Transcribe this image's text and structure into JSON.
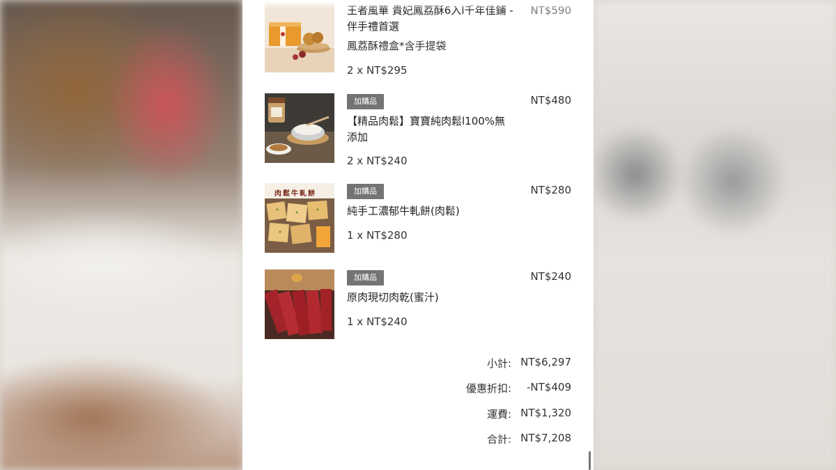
{
  "items": [
    {
      "name": "王者風華 貴妃鳳荔酥6入l千年佳鋪 - 伴手禮首選",
      "option": "鳳荔酥禮盒*含手提袋",
      "qty": "2 x NT$295",
      "price": "NT$590",
      "badge": "",
      "image": "pastry-gift-box"
    },
    {
      "badge": "加購品",
      "name": "【精品肉鬆】寶寶純肉鬆l100%無添加",
      "qty": "2 x NT$240",
      "price": "NT$480",
      "image": "pork-floss-jar"
    },
    {
      "badge": "加購品",
      "name": "純手工濃郁牛軋餅(肉鬆)",
      "qty": "1 x NT$280",
      "price": "NT$280",
      "image": "nougat-crackers",
      "image_text": "肉鬆牛軋餅"
    },
    {
      "badge": "加購品",
      "name": "原肉現切肉乾(蜜汁)",
      "qty": "1 x NT$240",
      "price": "NT$240",
      "image": "jerky"
    }
  ],
  "summary": {
    "subtotal_label": "小計:",
    "subtotal_value": "NT$6,297",
    "discount_label": "優惠折扣:",
    "discount_value": "-NT$409",
    "shipping_label": "運費:",
    "shipping_value": "NT$1,320",
    "total_label": "合計:",
    "total_value": "NT$7,208"
  },
  "colors": {
    "badge_bg": "#747474",
    "text": "#333333"
  }
}
